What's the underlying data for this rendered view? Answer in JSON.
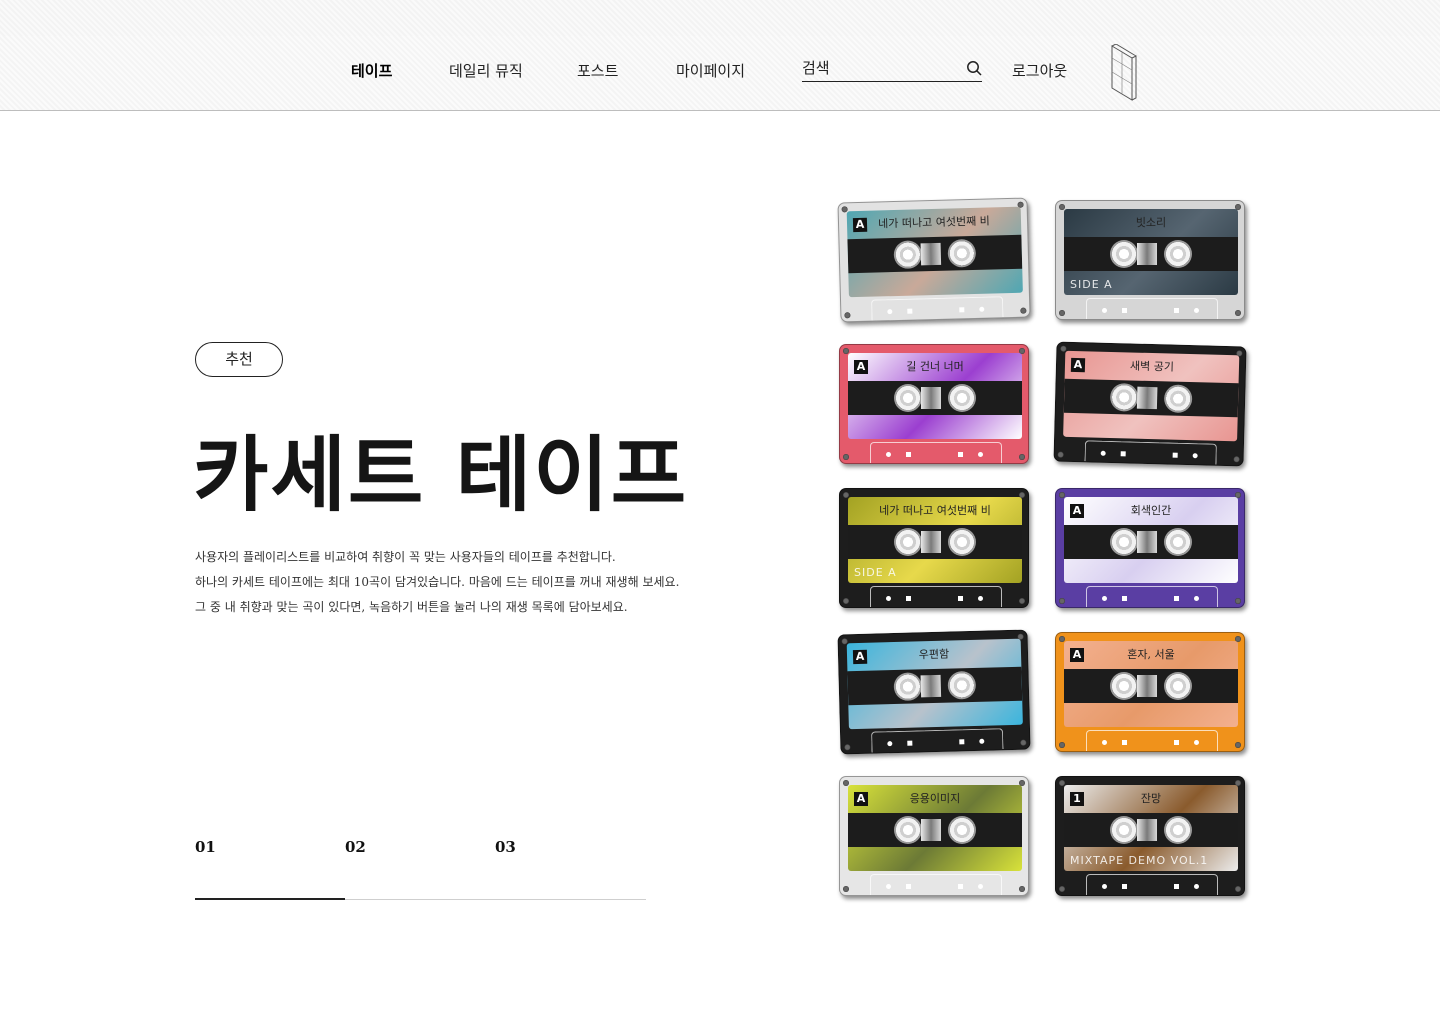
{
  "nav": {
    "items": [
      {
        "label": "테이프",
        "active": true
      },
      {
        "label": "데일리 뮤직"
      },
      {
        "label": "포스트"
      },
      {
        "label": "마이페이지"
      }
    ],
    "search_placeholder": "검색",
    "logout_label": "로그아웃"
  },
  "hero": {
    "badge": "추천",
    "title": "카세트 테이프",
    "description": [
      "사용자의 플레이리스트를 비교하여 취향이 꼭 맞는 사용자들의 테이프를 추천합니다.",
      "하나의 카세트 테이프에는 최대 10곡이 담겨있습니다. 마음에 드는 테이프를 꺼내 재생해 보세요.",
      "그 중 내 취향과 맞는 곡이 있다면, 녹음하기 버튼을 눌러 나의 재생 목록에 담아보세요."
    ]
  },
  "pagination": {
    "pages": [
      "01",
      "02",
      "03"
    ],
    "current": 1,
    "total": 3
  },
  "tapes": [
    {
      "title": "네가 떠나고 여섯번째 비",
      "side": "A",
      "side_text": "",
      "shell": "#e2e2e2",
      "label_color": "#4fa7b3",
      "accent": "#c9a999"
    },
    {
      "title": "빗소리",
      "side": "",
      "side_text": "SIDE A",
      "shell": "#d6d6d6",
      "label_color": "#2b3a44",
      "accent": "#566571"
    },
    {
      "title": "길 건너 너머",
      "side": "A",
      "side_text": "",
      "shell": "#e45a6b",
      "label_color": "#ffffff",
      "accent": "#9b3fd0"
    },
    {
      "title": "새벽 공기",
      "side": "A",
      "side_text": "",
      "shell": "#1d1d1d",
      "label_color": "#e89591",
      "accent": "#f0c2bf"
    },
    {
      "title": "네가 떠나고 여섯번째 비",
      "side": "",
      "side_text": "SIDE A",
      "shell": "#1d1d1d",
      "label_color": "#a3a223",
      "accent": "#e7d94b"
    },
    {
      "title": "회색인간",
      "side": "A",
      "side_text": "",
      "shell": "#5a3ea3",
      "label_color": "#ffffff",
      "accent": "#d8cff0"
    },
    {
      "title": "우편함",
      "side": "A",
      "side_text": "",
      "shell": "#1d1d1d",
      "label_color": "#3ab5dd",
      "accent": "#b8c2cc"
    },
    {
      "title": "혼자, 서울",
      "side": "A",
      "side_text": "",
      "shell": "#f0921b",
      "label_color": "#f3b08f",
      "accent": "#e79a6a"
    },
    {
      "title": "응용이미지",
      "side": "A",
      "side_text": "",
      "shell": "#e6e6e6",
      "label_color": "#d8e23a",
      "accent": "#6c7a36"
    },
    {
      "title": "잔망",
      "side": "1",
      "side_text": "MIXTAPE DEMO VOL.1",
      "shell": "#1d1d1d",
      "label_color": "#ececec",
      "accent": "#8a5b2d"
    }
  ]
}
